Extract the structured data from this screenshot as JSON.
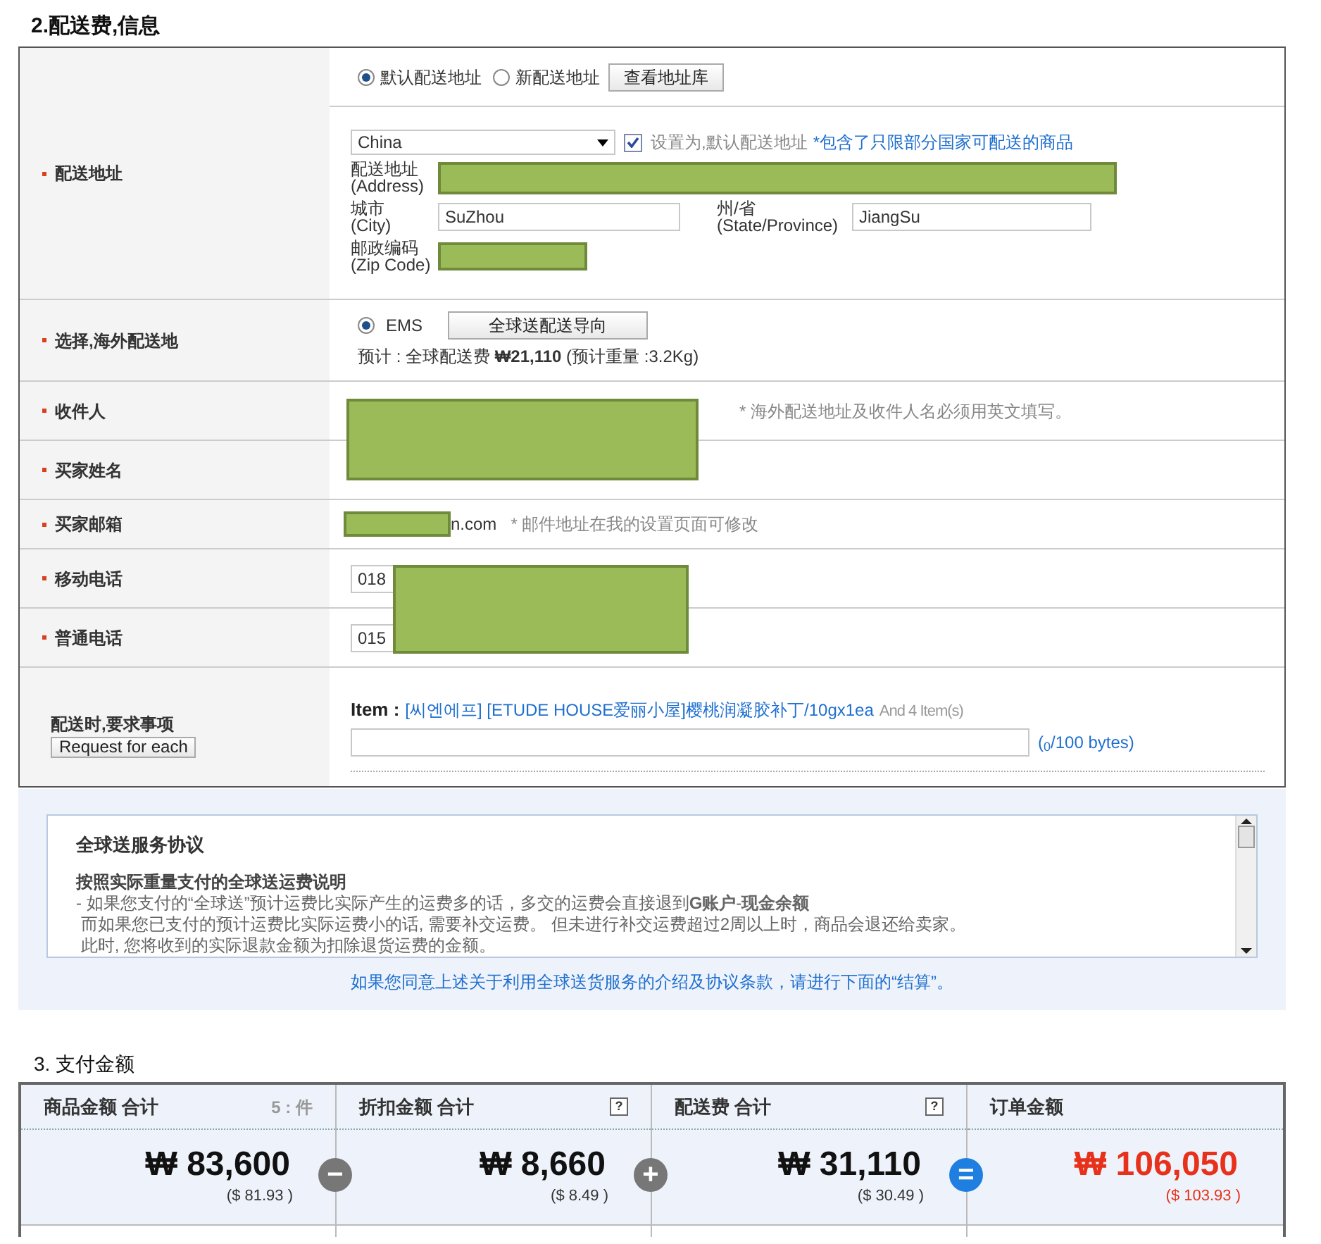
{
  "section2_title": "2.配送费,信息",
  "address": {
    "label": "配送地址",
    "address_type": [
      {
        "label": "默认配送地址",
        "selected": true
      },
      {
        "label": "新配送地址",
        "selected": false
      }
    ],
    "address_book_button": "查看地址库",
    "country": "China",
    "set_default": {
      "label": "设置为,默认配送地址",
      "checked": true
    },
    "notice": "*包含了只限部分国家可配送的商品",
    "street": {
      "label": "配送地址",
      "sublabel": "(Address)",
      "redacted": true
    },
    "city": {
      "label": "城市",
      "sublabel": "(City)",
      "value": "SuZhou"
    },
    "state": {
      "label": "州/省",
      "sublabel": "(State/Province)",
      "value": "JiangSu"
    },
    "zip": {
      "label": "邮政编码",
      "sublabel": "(Zip Code)",
      "redacted": true
    }
  },
  "shipping": {
    "label": "选择,海外配送地",
    "methods": [
      {
        "label": "EMS",
        "selected": true
      }
    ],
    "guide_button": "全球送配送导向",
    "estimate": "预计 : 全球配送费 **₩21,110** (预计重量 :3.2Kg)"
  },
  "recipient": {
    "label": "收件人",
    "note": "* 海外配送地址及收件人名必须用英文填写。",
    "redacted": true
  },
  "buyer_name": {
    "label": "买家姓名"
  },
  "email": {
    "label": "买家邮箱",
    "value": "n.com",
    "note": "* 邮件地址在我的设置页面可修改",
    "redacted": true
  },
  "mobile": {
    "label": "移动电话",
    "value": "018",
    "redacted": true
  },
  "phone": {
    "label": "普通电话",
    "value": "015"
  },
  "request": {
    "label": "配送时,要求事项",
    "button": "Request for each",
    "item_label": "Item :",
    "item_link": "[씨엔에프] [ETUDE HOUSE爱丽小屋]樱桃润凝胶补丁/10gx1ea",
    "item_more": "And 4 Item(s)",
    "counter": "($_{0}$/100 bytes)"
  },
  "agreement": {
    "title": "全球送服务协议",
    "heading": "按照实际重量支付的全球送运费说明",
    "lines": [
      "- 如果您支付的“全球送”预计运费比实际产生的运费多的话，多交的运费会直接退到**G账户**-**现金余额**",
      " 而如果您已支付的预计运费比实际运费小的话, 需要补交运费。 但未进行补交运费超过2周以上时，商品会退还给卖家。",
      " 此时, 您将收到的实际退款金额为扣除退货运费的金额。"
    ],
    "footer": "如果您同意上述关于利用全球送货服务的介绍及协议条款，请进行下面的“结算”。"
  },
  "section3_title": "3. 支付金额",
  "totals": [
    {
      "title": "商品金额 合计",
      "count": "5 : 件",
      "amount": "₩ 83,600",
      "usd": "($ 81.93 )",
      "operator": "−",
      "color": "#777777",
      "kind": "normal"
    },
    {
      "title": "折扣金额 合计",
      "help": "?",
      "amount": "₩ 8,660",
      "usd": "($ 8.49 )",
      "operator": "+",
      "color": "#777777",
      "kind": "normal"
    },
    {
      "title": "配送费 合计",
      "help": "?",
      "amount": "₩ 31,110",
      "usd": "($ 30.49 )",
      "operator": "=",
      "color": "#1f7fe0",
      "kind": "normal"
    },
    {
      "title": "订单金额",
      "amount": "₩ 106,050",
      "usd": "($ 103.93 )",
      "kind": "total"
    }
  ]
}
